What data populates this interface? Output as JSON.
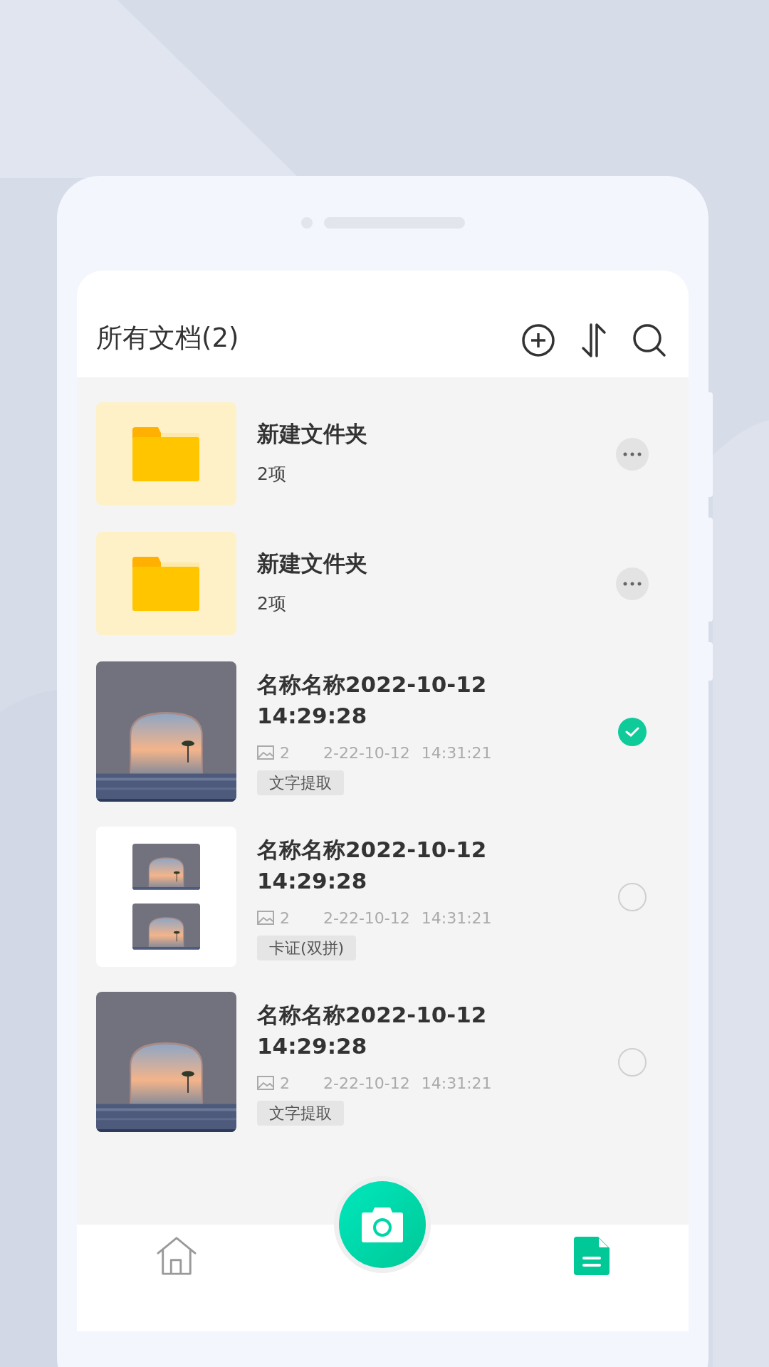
{
  "header": {
    "title": "所有文档(2)"
  },
  "items": [
    {
      "kind": "folder",
      "name": "新建文件夹",
      "count": "2项"
    },
    {
      "kind": "folder",
      "name": "新建文件夹",
      "count": "2项"
    },
    {
      "kind": "scan",
      "title_lines": [
        "名称名称2022-10-12",
        "14:29:28"
      ],
      "pages": "2",
      "date": "2-22-10-12",
      "time": "14:31:21",
      "tag": "文字提取",
      "selected": true
    },
    {
      "kind": "card",
      "title_lines": [
        "名称名称2022-10-12",
        "14:29:28"
      ],
      "pages": "2",
      "date": "2-22-10-12",
      "time": "14:31:21",
      "tag": "卡证(双拼)",
      "selected": false
    },
    {
      "kind": "scan",
      "title_lines": [
        "名称名称2022-10-12",
        "14:29:28"
      ],
      "pages": "2",
      "date": "2-22-10-12",
      "time": "14:31:21",
      "tag": "文字提取",
      "selected": false
    }
  ],
  "nav": [
    {
      "kind": "home",
      "selected": false
    },
    {
      "kind": "camera",
      "selected": false
    },
    {
      "kind": "documents",
      "selected": true
    }
  ]
}
